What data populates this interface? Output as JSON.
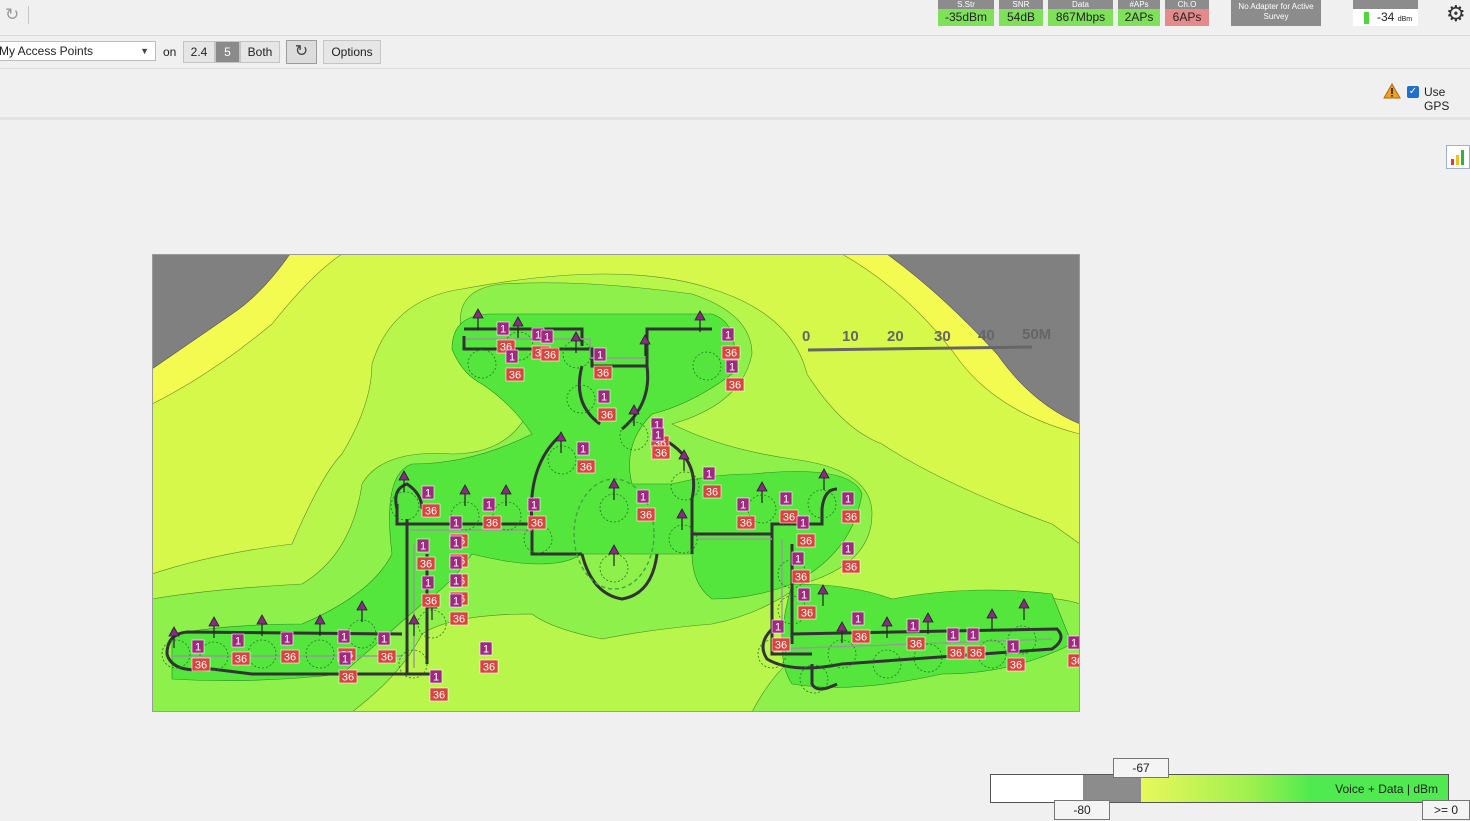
{
  "toolbar_top": {
    "stats": [
      {
        "label": "S.Str",
        "value": "-35dBm",
        "status": "good"
      },
      {
        "label": "SNR",
        "value": "54dB",
        "status": "good"
      },
      {
        "label": "Data",
        "value": "867Mbps",
        "status": "good"
      },
      {
        "label": "#APs",
        "value": "2APs",
        "status": "good"
      },
      {
        "label": "Ch.O",
        "value": "6APs",
        "status": "bad"
      }
    ],
    "adapter_status": "No Adapter for Active Survey",
    "signal_value": "-34",
    "signal_unit": "dBm",
    "redo_icon": "redo-icon",
    "gear_icon": "gear-icon"
  },
  "toolbar": {
    "ap_filter": "My Access Points",
    "on_label": "on",
    "bands": [
      "2.4",
      "5",
      "Both"
    ],
    "selected_band": "5",
    "options_label": "Options"
  },
  "row2": {
    "use_gps_label": "Use GPS",
    "use_gps_checked": true
  },
  "map": {
    "scale_labels": [
      "0",
      "10",
      "20",
      "30",
      "40",
      "50M"
    ],
    "ap_channel_24": "1",
    "ap_channel_5": "36"
  },
  "legend": {
    "label": "Voice + Data |  dBm",
    "threshold_top": "-67",
    "threshold_bottom": "-80",
    "max_label": ">= 0"
  },
  "colors": {
    "strong_green": "#4fea4f",
    "mid_green": "#9ef04e",
    "yellow_green": "#d6f84a",
    "yellow": "#f4fb50",
    "no_signal": "#808080",
    "badge_24": "#a0287e",
    "badge_5": "#d9443c"
  }
}
